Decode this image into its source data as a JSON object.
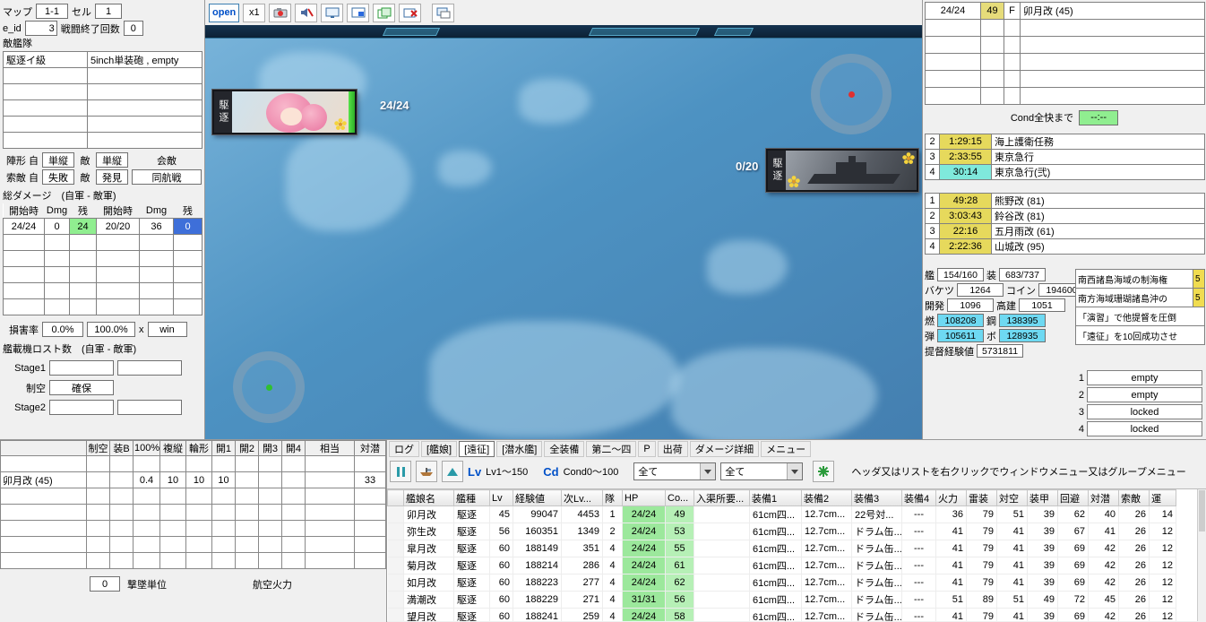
{
  "colors": {
    "hp_green": "#90EE90",
    "rest_blue": "#3E6FD9",
    "timer_yellow": "#E6D95C",
    "timer_cyan": "#7FE9DC",
    "resource_cyan": "#6ED9F2",
    "quest_pink": "#FFB9C5",
    "badge_yellow": "#F0DC50",
    "slot_cyan": "#BDF3F3",
    "cond_yellow": "#E6DC7A",
    "hp_cell_green": "#9CE89C",
    "accent_blue": "#0050C8"
  },
  "battle_panel": {
    "map_label": "マップ",
    "map_value": "1-1",
    "cell_label": "セル",
    "cell_value": "1",
    "eid_label": "e_id",
    "eid_value": "3",
    "count_label": "戦闘終了回数",
    "count_value": "0",
    "enemy_fleet_label": "敵艦隊",
    "enemy_rows": [
      {
        "name": "駆逐イ級",
        "equip": "5inch単装砲 , empty"
      },
      {
        "name": "",
        "equip": ""
      },
      {
        "name": "",
        "equip": ""
      },
      {
        "name": "",
        "equip": ""
      },
      {
        "name": "",
        "equip": ""
      },
      {
        "name": "",
        "equip": ""
      }
    ],
    "formation_label": "陣形 自",
    "formation_own": "単縦",
    "formation_enemy_label": "敵",
    "formation_enemy": "単縦",
    "engage_header": "会敵",
    "search_label": "索敵 自",
    "search_own": "失敗",
    "search_enemy_label": "敵",
    "search_enemy": "発見",
    "engage_value": "同航戦",
    "damage_title": "総ダメージ　(自軍 - 敵軍)",
    "damage_headers": [
      "開始時",
      "Dmg",
      "残",
      "開始時",
      "Dmg",
      "残"
    ],
    "damage_rows": [
      {
        "own_start": "24/24",
        "own_dmg": "0",
        "own_rest": "24",
        "own_rest_state": "green",
        "enemy_start": "20/20",
        "enemy_dmg": "36",
        "enemy_rest": "0",
        "enemy_rest_state": "blue"
      },
      {
        "own_start": "",
        "own_dmg": "",
        "own_rest": "",
        "enemy_start": "",
        "enemy_dmg": "",
        "enemy_rest": ""
      },
      {
        "own_start": "",
        "own_dmg": "",
        "own_rest": "",
        "enemy_start": "",
        "enemy_dmg": "",
        "enemy_rest": ""
      },
      {
        "own_start": "",
        "own_dmg": "",
        "own_rest": "",
        "enemy_start": "",
        "enemy_dmg": "",
        "enemy_rest": ""
      },
      {
        "own_start": "",
        "own_dmg": "",
        "own_rest": "",
        "enemy_start": "",
        "enemy_dmg": "",
        "enemy_rest": ""
      },
      {
        "own_start": "",
        "own_dmg": "",
        "own_rest": "",
        "enemy_start": "",
        "enemy_dmg": "",
        "enemy_rest": ""
      }
    ],
    "loss_label": "損害率",
    "own_loss": "0.0%",
    "enemy_loss": "100.0%",
    "multiply_label": "x",
    "result_value": "win",
    "plane_loss_title": "艦載機ロスト数　(自軍 - 敵軍)",
    "stage1_label": "Stage1",
    "air_state_label": "制空",
    "air_state_value": "確保",
    "stage2_label": "Stage2"
  },
  "aircraft_panel": {
    "headers": [
      "制空",
      "装B",
      "100%",
      "複縦",
      "輪形",
      "開1",
      "開2",
      "開3",
      "開4",
      "相当",
      "対潜"
    ],
    "row_name": "卯月改 (45)",
    "row_values": [
      "",
      "",
      "0.4",
      "10",
      "10",
      "10",
      "",
      "",
      "",
      "",
      "33"
    ],
    "footer_value": "0",
    "footer_label1": "撃墜単位",
    "footer_label2": "航空火力"
  },
  "game": {
    "open_button": "open",
    "scale_button": "x1",
    "own_class": "駆逐",
    "own_hp_label": "24/24",
    "enemy_class": "駆逐",
    "enemy_hp_label": "0/20"
  },
  "fleet_panel": {
    "members": [
      {
        "hp": "24/24",
        "cond": "49",
        "flag": "F",
        "name": "卯月改 (45)",
        "cond_state": "yellow"
      },
      {
        "hp": "",
        "cond": "",
        "flag": "",
        "name": ""
      },
      {
        "hp": "",
        "cond": "",
        "flag": "",
        "name": ""
      },
      {
        "hp": "",
        "cond": "",
        "flag": "",
        "name": ""
      },
      {
        "hp": "",
        "cond": "",
        "flag": "",
        "name": ""
      },
      {
        "hp": "",
        "cond": "",
        "flag": "",
        "name": ""
      }
    ],
    "cond_recover_label": "Cond全快まで",
    "cond_recover_value": "--:--",
    "expeditions": [
      {
        "num": "2",
        "time": "1:29:15",
        "name": "海上護衛任務",
        "state": "yellow"
      },
      {
        "num": "3",
        "time": "2:33:55",
        "name": "東京急行",
        "state": "yellow"
      },
      {
        "num": "4",
        "time": "30:14",
        "name": "東京急行(弐)",
        "state": "cyan"
      }
    ],
    "docks": [
      {
        "num": "1",
        "time": "49:28",
        "name": "熊野改 (81)",
        "state": "yellow"
      },
      {
        "num": "2",
        "time": "3:03:43",
        "name": "鈴谷改 (81)",
        "state": "yellow"
      },
      {
        "num": "3",
        "time": "22:16",
        "name": "五月雨改 (61)",
        "state": "yellow"
      },
      {
        "num": "4",
        "time": "2:22:36",
        "name": "山城改 (95)",
        "state": "yellow"
      }
    ],
    "resources": [
      {
        "label": "艦",
        "value": "154/160"
      },
      {
        "label": "装",
        "value": "683/737"
      },
      {
        "label": "バケツ",
        "value": "1264"
      },
      {
        "label": "コイン",
        "value": "194600"
      },
      {
        "label": "開発",
        "value": "1096"
      },
      {
        "label": "高建",
        "value": "1051"
      },
      {
        "label": "燃",
        "value": "108208",
        "state": "cyan"
      },
      {
        "label": "鋼",
        "value": "138395",
        "state": "cyan"
      },
      {
        "label": "弾",
        "value": "105611",
        "state": "cyan"
      },
      {
        "label": "ボ",
        "value": "128935",
        "state": "cyan"
      },
      {
        "label": "提督経験値",
        "value": "5731811"
      }
    ],
    "quests": [
      {
        "text": "南西諸島海域の制海権",
        "badge": "5",
        "state": "pink"
      },
      {
        "text": "南方海域珊瑚諸島沖の",
        "badge": "5",
        "state": "pink"
      },
      {
        "text": "「演習」で他提督を圧倒",
        "badge": "",
        "state": "white"
      },
      {
        "text": "「遠征」を10回成功させ",
        "badge": "",
        "state": "white"
      }
    ],
    "slots": [
      {
        "num": "1",
        "label": "empty",
        "state": "cyan"
      },
      {
        "num": "2",
        "label": "empty",
        "state": "cyan"
      },
      {
        "num": "3",
        "label": "locked",
        "state": "white"
      },
      {
        "num": "4",
        "label": "locked",
        "state": "white"
      }
    ]
  },
  "shiplist": {
    "tabs": [
      "ログ",
      "[艦娘]",
      "[遠征]",
      "[潜水艦]",
      "全装備",
      "第二〜四",
      "P",
      "出荷",
      "ダメージ詳細",
      "メニュー"
    ],
    "active_tab": 2,
    "filters": {
      "lv_label": "Lv",
      "lv_range": "Lv1〜150",
      "cd_label": "Cd",
      "cd_range": "Cond0〜100",
      "combo1": "全て",
      "combo2": "全て",
      "hint": "ヘッダ又はリストを右クリックでウィンドウメニュー又はグループメニュー"
    },
    "headers": [
      "艦娘名",
      "艦種",
      "Lv",
      "経験値",
      "次Lv...",
      "隊",
      "HP",
      "Co...",
      "入渠所要...",
      "装備1",
      "装備2",
      "装備3",
      "装備4",
      "火力",
      "雷装",
      "対空",
      "装甲",
      "回避",
      "対潜",
      "索敵",
      "運"
    ],
    "rows": [
      [
        "卯月改",
        "駆逐",
        "45",
        "99047",
        "4453",
        "1",
        "24/24",
        "49",
        "",
        "61cm四...",
        "12.7cm...",
        "22号対...",
        "---",
        "36",
        "79",
        "51",
        "39",
        "62",
        "40",
        "26",
        "14"
      ],
      [
        "弥生改",
        "駆逐",
        "56",
        "160351",
        "1349",
        "2",
        "24/24",
        "53",
        "",
        "61cm四...",
        "12.7cm...",
        "ドラム缶...",
        "---",
        "41",
        "79",
        "41",
        "39",
        "67",
        "41",
        "26",
        "12"
      ],
      [
        "皐月改",
        "駆逐",
        "60",
        "188149",
        "351",
        "4",
        "24/24",
        "55",
        "",
        "61cm四...",
        "12.7cm...",
        "ドラム缶...",
        "---",
        "41",
        "79",
        "41",
        "39",
        "69",
        "42",
        "26",
        "12"
      ],
      [
        "菊月改",
        "駆逐",
        "60",
        "188214",
        "286",
        "4",
        "24/24",
        "61",
        "",
        "61cm四...",
        "12.7cm...",
        "ドラム缶...",
        "---",
        "41",
        "79",
        "41",
        "39",
        "69",
        "42",
        "26",
        "12"
      ],
      [
        "如月改",
        "駆逐",
        "60",
        "188223",
        "277",
        "4",
        "24/24",
        "62",
        "",
        "61cm四...",
        "12.7cm...",
        "ドラム缶...",
        "---",
        "41",
        "79",
        "41",
        "39",
        "69",
        "42",
        "26",
        "12"
      ],
      [
        "満潮改",
        "駆逐",
        "60",
        "188229",
        "271",
        "4",
        "31/31",
        "56",
        "",
        "61cm四...",
        "12.7cm...",
        "ドラム缶...",
        "---",
        "51",
        "89",
        "51",
        "49",
        "72",
        "45",
        "26",
        "12"
      ],
      [
        "望月改",
        "駆逐",
        "60",
        "188241",
        "259",
        "4",
        "24/24",
        "58",
        "",
        "61cm四...",
        "12.7cm...",
        "ドラム缶...",
        "---",
        "41",
        "79",
        "41",
        "39",
        "69",
        "42",
        "26",
        "12"
      ]
    ]
  }
}
